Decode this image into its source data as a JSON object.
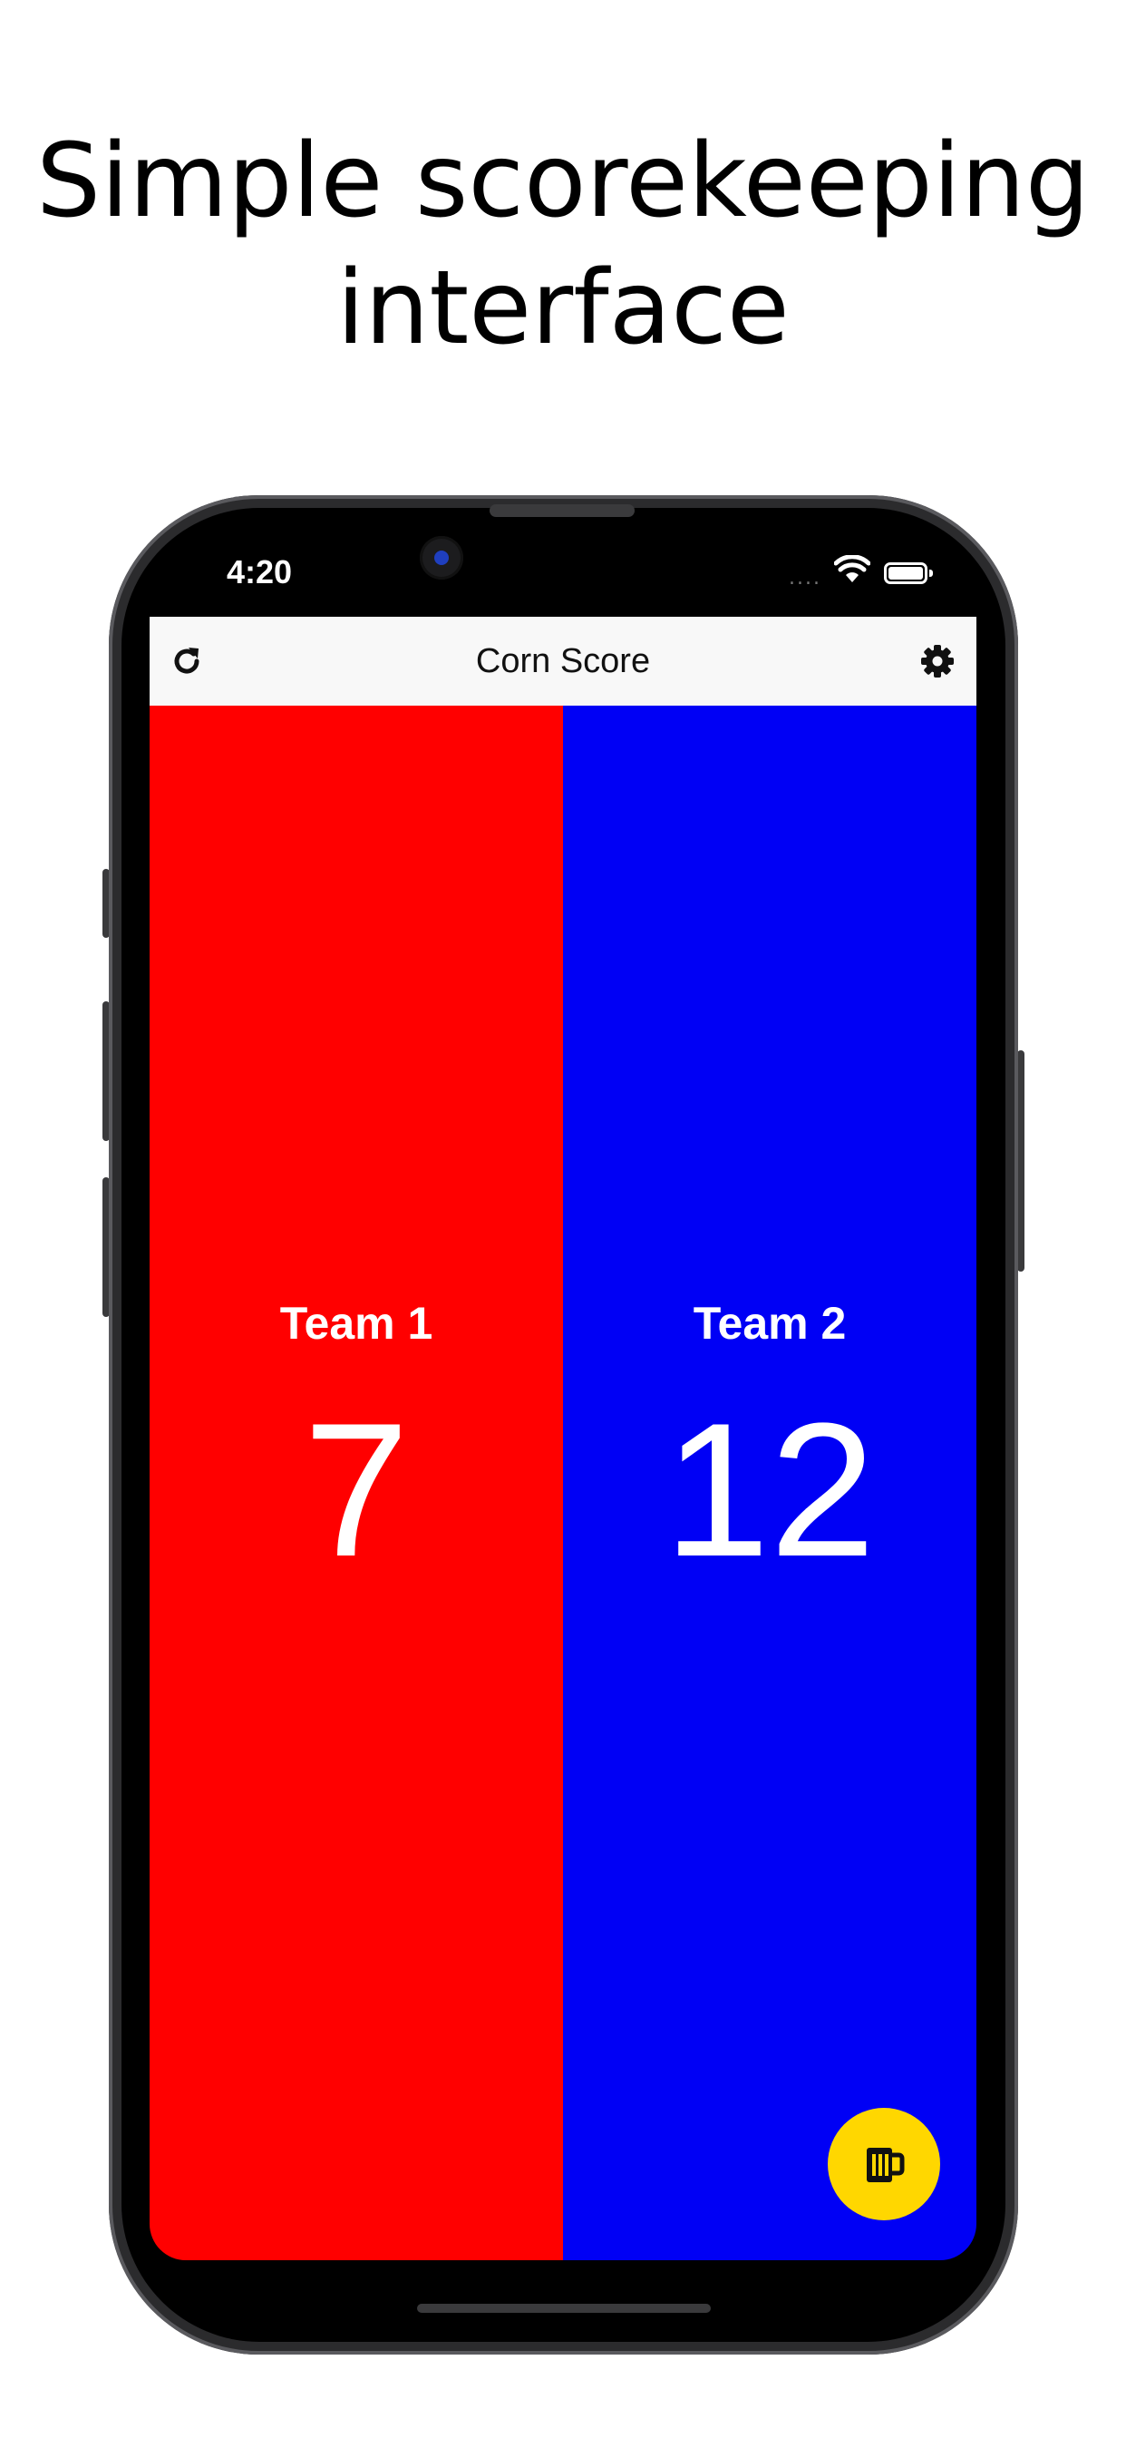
{
  "headline": {
    "line1": "Simple scorekeeping",
    "line2": "interface"
  },
  "status_bar": {
    "time": "4:20",
    "signal": "....",
    "icons": [
      "wifi-icon",
      "battery-icon"
    ]
  },
  "nav": {
    "title": "Corn Score",
    "left_icon": "reset-icon",
    "right_icon": "gear-icon"
  },
  "teams": [
    {
      "name": "Team 1",
      "score": "7",
      "color": "#ff0000"
    },
    {
      "name": "Team 2",
      "score": "12",
      "color": "#0000f5"
    }
  ],
  "fab": {
    "icon": "beer-mug-icon",
    "color": "#ffd700"
  }
}
